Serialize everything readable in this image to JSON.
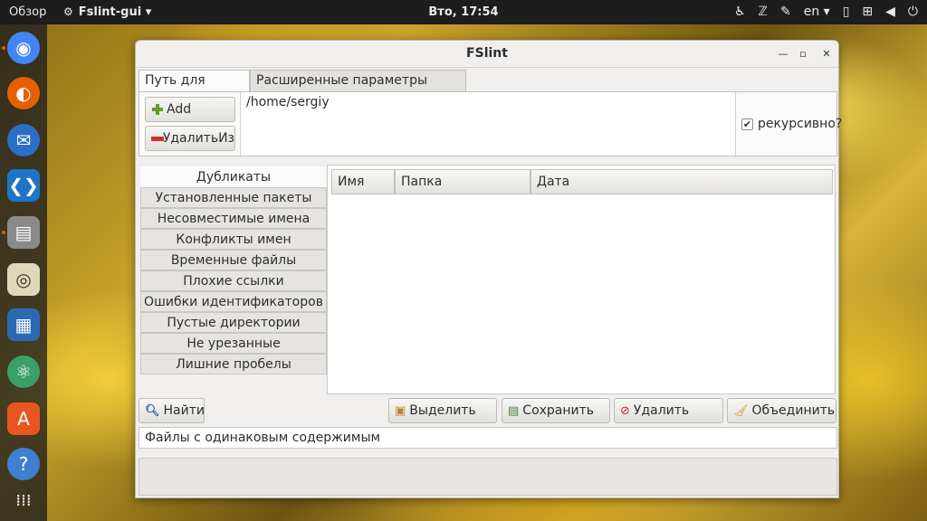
{
  "topbar": {
    "overview": "Обзор",
    "app_name": "Fslint-gui ▾",
    "clock": "Вто, 17:54",
    "lang": "en ▾"
  },
  "dock": {
    "items": [
      "chrome-icon",
      "firefox-icon",
      "thunderbird-icon",
      "vscode-icon",
      "files-icon",
      "rhythmbox-icon",
      "writer-icon",
      "atom-icon",
      "software-center-icon",
      "help-icon",
      "show-apps-icon"
    ]
  },
  "window": {
    "title": "FSlint",
    "tabs": [
      {
        "label": "Путь для поиска"
      },
      {
        "label": "Расширенные параметры поиска"
      }
    ],
    "add_label": "Add",
    "remove_label": "УдалитьИз",
    "path": "/home/sergiy",
    "recursive_label": "рекурсивно?",
    "recursive_checked": true,
    "categories": [
      "Дубликаты",
      "Установленные пакеты",
      "Несовместимые имена",
      "Конфликты имен",
      "Временные файлы",
      "Плохие ссылки",
      "Ошибки идентификаторов",
      "Пустые директории",
      "Не урезанные исполняемые",
      "Лишние пробелы"
    ],
    "columns": [
      "Имя",
      "Папка",
      "Дата"
    ],
    "buttons": {
      "find": "Найти",
      "select": "Выделить",
      "save": "Сохранить",
      "delete": "Удалить",
      "merge": "Объединить"
    },
    "description": "Файлы с одинаковым содержимым"
  },
  "colors": {
    "dock_running": "#e95420",
    "topbar": "#1d1d1d"
  }
}
